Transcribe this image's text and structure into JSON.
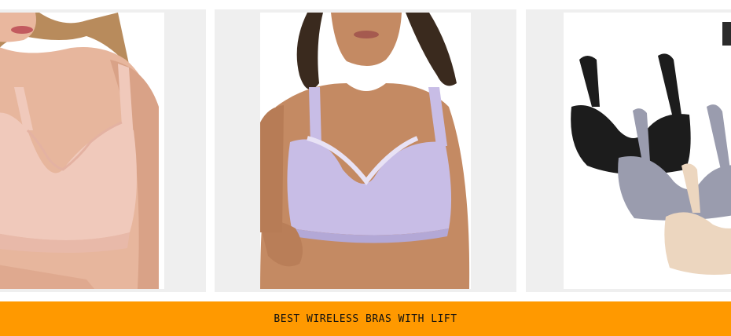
{
  "products": [
    {
      "image_alt": "pink wireless bra",
      "icon": "product-image",
      "accent": "#f0c9bb"
    },
    {
      "image_alt": "lavender wireless bra",
      "icon": "product-image",
      "accent": "#c8bde6"
    },
    {
      "image_alt": "black grey beige wireless bras pack",
      "icon": "product-image",
      "accent": "#1c1c1c"
    }
  ],
  "banner": {
    "label": "BEST WIRELESS BRAS WITH LIFT",
    "color": "#ff9900"
  }
}
